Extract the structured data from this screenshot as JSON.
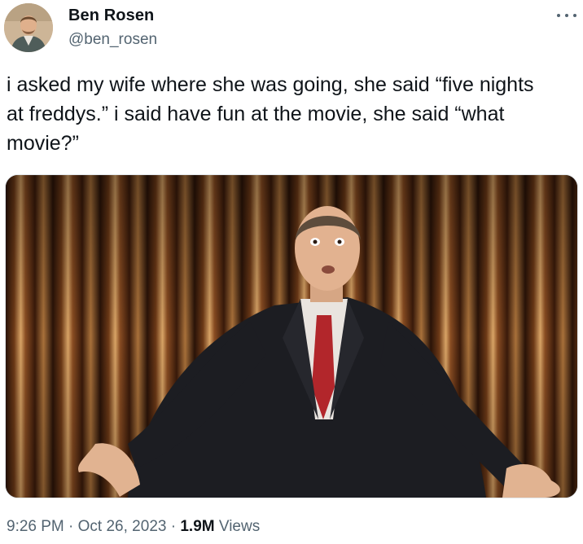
{
  "author": {
    "name": "Ben Rosen",
    "handle": "@ben_rosen",
    "avatar_icon": "profile-photo"
  },
  "tweet": {
    "text": "i asked my wife where she was going, she said “five nights\nat freddys.” i said have fun at the movie, she said “what\nmovie?”",
    "media_icon": "comedian-on-stage-photo"
  },
  "meta": {
    "time": "9:26 PM",
    "sep1": " · ",
    "date": "Oct 26, 2023",
    "sep2": " · ",
    "views_count": "1.9M",
    "views_label": " Views"
  },
  "colors": {
    "text": "#0f1419",
    "secondary": "#536471"
  }
}
